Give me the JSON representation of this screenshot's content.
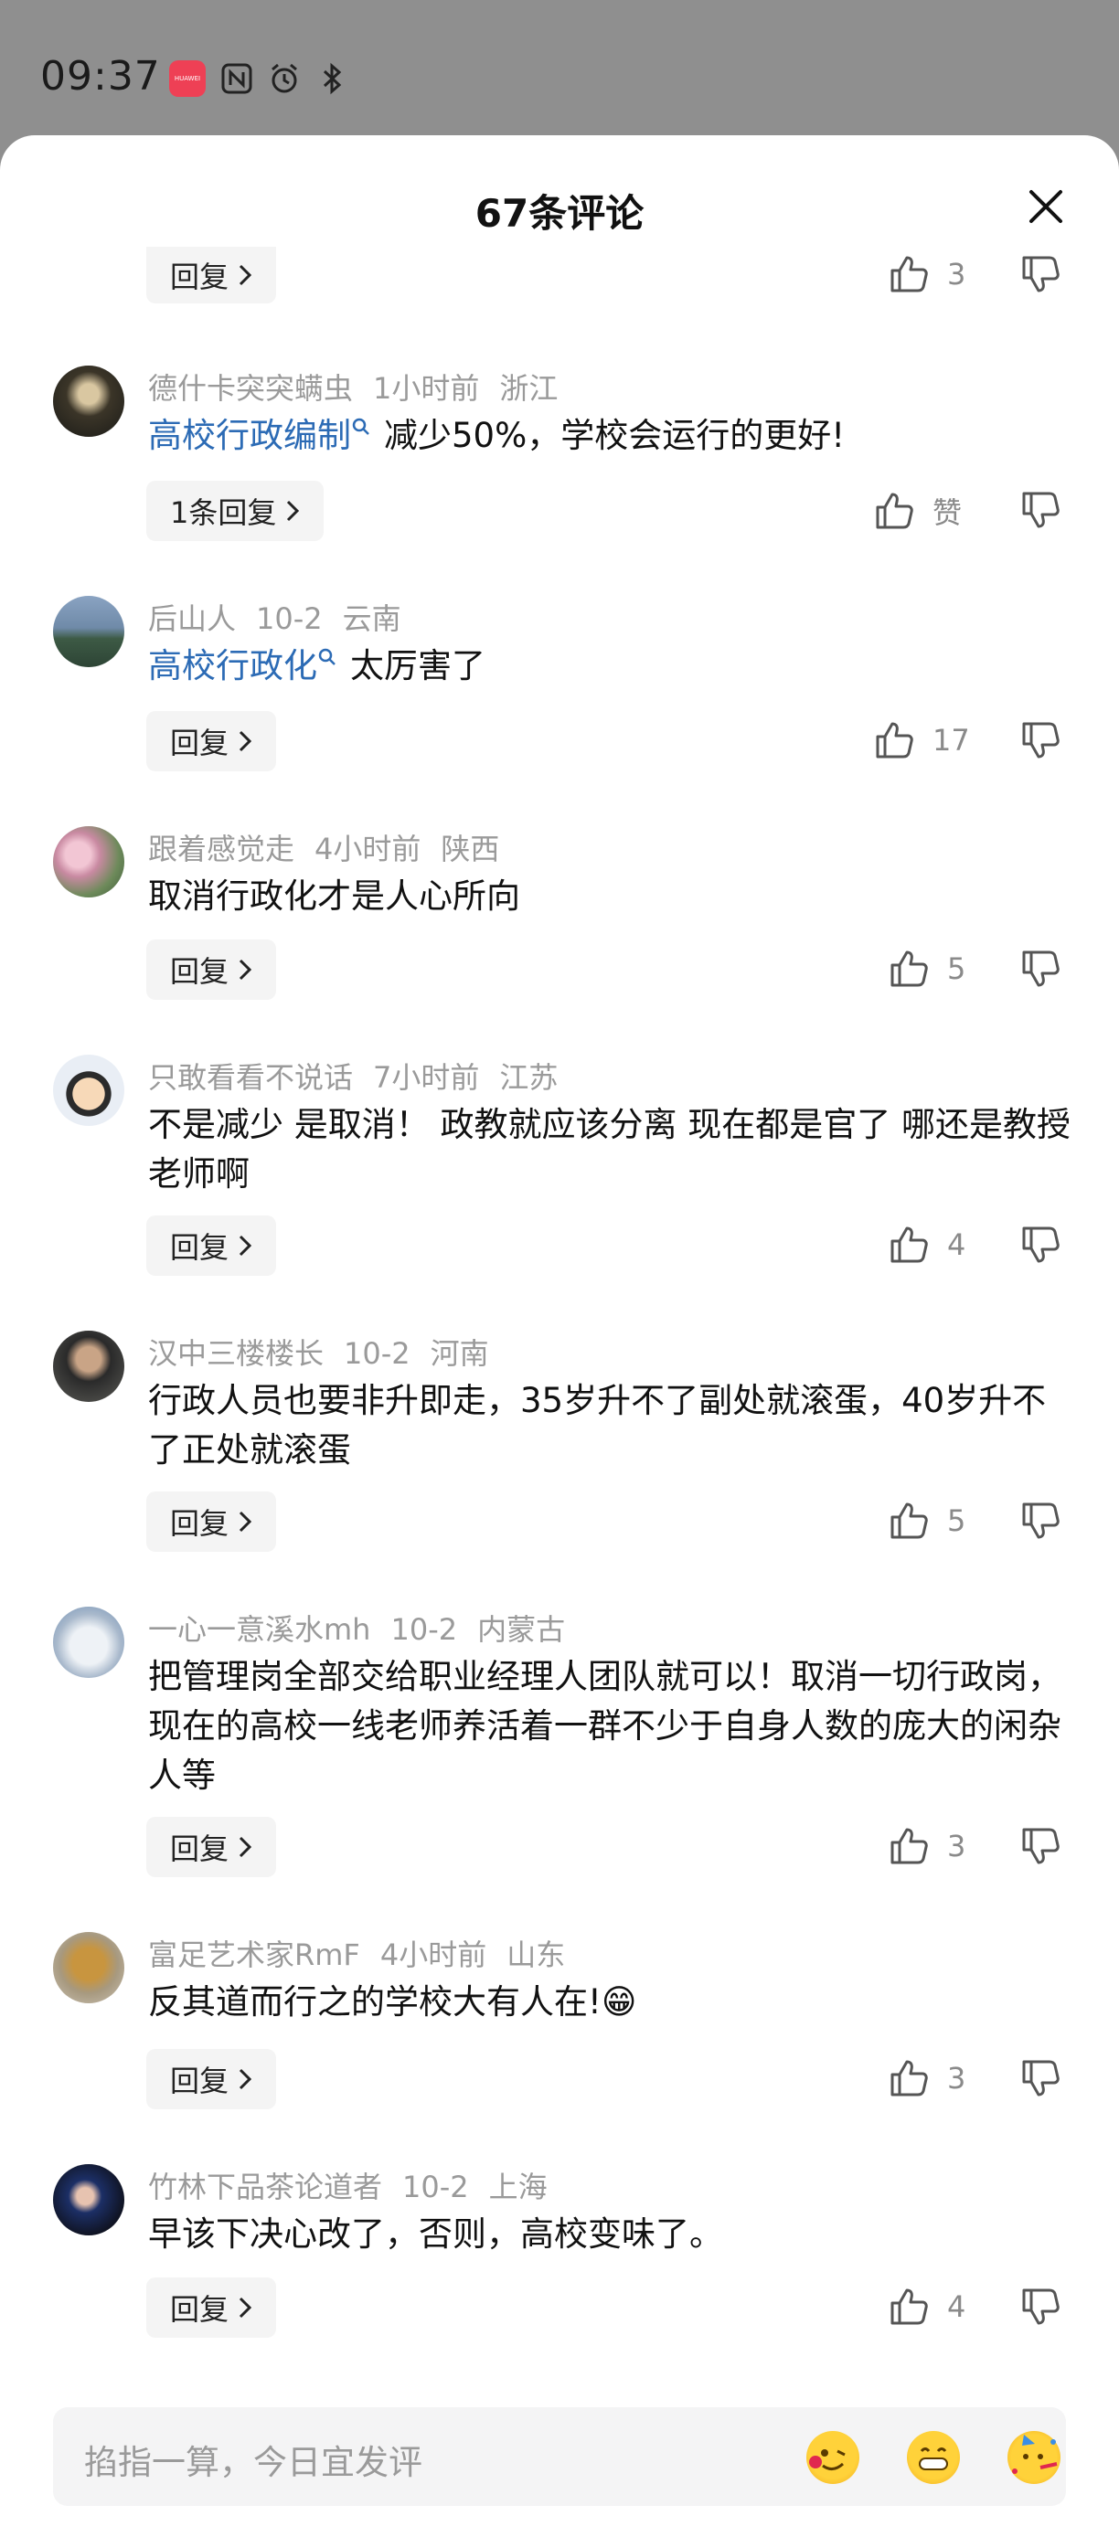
{
  "status_bar": {
    "time": "09:37",
    "badge": "HUAWEI"
  },
  "header": {
    "title": "67条评论"
  },
  "top_partial": {
    "reply_label": "回复",
    "likes": "3"
  },
  "comments": [
    {
      "user": "德什卡突突螨虫",
      "time": "1小时前",
      "location": "浙江",
      "keyword": "高校行政编制",
      "text": "减少50%，学校会运行的更好!",
      "reply_label": "1条回复",
      "likes": "赞"
    },
    {
      "user": "后山人",
      "time": "10-2",
      "location": "云南",
      "keyword": "高校行政化",
      "text": "太厉害了",
      "reply_label": "回复",
      "likes": "17"
    },
    {
      "user": "跟着感觉走",
      "time": "4小时前",
      "location": "陕西",
      "keyword": "",
      "text": "取消行政化才是人心所向",
      "reply_label": "回复",
      "likes": "5"
    },
    {
      "user": "只敢看看不说话",
      "time": "7小时前",
      "location": "江苏",
      "keyword": "",
      "text": "不是减少 是取消！ 政教就应该分离 现在都是官了 哪还是教授 老师啊",
      "reply_label": "回复",
      "likes": "4"
    },
    {
      "user": "汉中三楼楼长",
      "time": "10-2",
      "location": "河南",
      "keyword": "",
      "text": "行政人员也要非升即走，35岁升不了副处就滚蛋，40岁升不了正处就滚蛋",
      "reply_label": "回复",
      "likes": "5"
    },
    {
      "user": "一心一意溪水mh",
      "time": "10-2",
      "location": "内蒙古",
      "keyword": "",
      "text": "把管理岗全部交给职业经理人团队就可以！取消一切行政岗，现在的高校一线老师养活着一群不少于自身人数的庞大的闲杂人等",
      "reply_label": "回复",
      "likes": "3"
    },
    {
      "user": "富足艺术家RmF",
      "time": "4小时前",
      "location": "山东",
      "keyword": "",
      "text": "反其道而行之的学校大有人在!😁",
      "reply_label": "回复",
      "likes": "3"
    },
    {
      "user": "竹林下品茶论道者",
      "time": "10-2",
      "location": "上海",
      "keyword": "",
      "text": "早该下决心改了，否则，高校变味了。",
      "reply_label": "回复",
      "likes": "4"
    }
  ],
  "input": {
    "placeholder": "掐指一算，今日宜发评"
  },
  "colors": {
    "accent": "#2c6bb5",
    "meta": "#9a9a9a",
    "sheet": "#ffffff",
    "backdrop": "#8f8f8f"
  }
}
